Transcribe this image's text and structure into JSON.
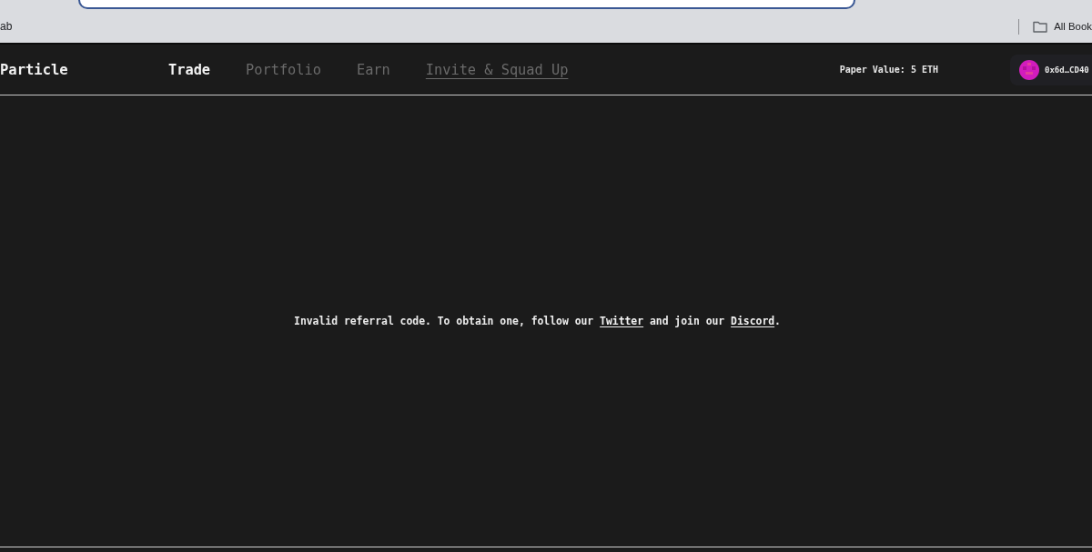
{
  "browser": {
    "bookmarks": [
      {
        "kind": "page",
        "label": "ab"
      },
      {
        "kind": "folder",
        "label": "All Book"
      }
    ]
  },
  "header": {
    "logo": "Particle",
    "nav": [
      {
        "kind": "tab",
        "label": "Trade",
        "selected": true
      },
      {
        "kind": "tab",
        "label": "Portfolio",
        "selected": false
      },
      {
        "kind": "tab",
        "label": "Earn",
        "selected": false
      },
      {
        "kind": "link",
        "label": "Invite & Squad Up",
        "selected": false
      }
    ],
    "paper_value": "Paper Value: 5 ETH",
    "wallet": {
      "address": "0x6d…CD40"
    }
  },
  "message": {
    "parts": [
      {
        "kind": "text",
        "text": "Invalid referral code. To obtain one, follow our "
      },
      {
        "kind": "link",
        "text": "Twitter"
      },
      {
        "kind": "text",
        "text": " and join our "
      },
      {
        "kind": "link",
        "text": "Discord"
      },
      {
        "kind": "text",
        "text": "."
      }
    ]
  }
}
